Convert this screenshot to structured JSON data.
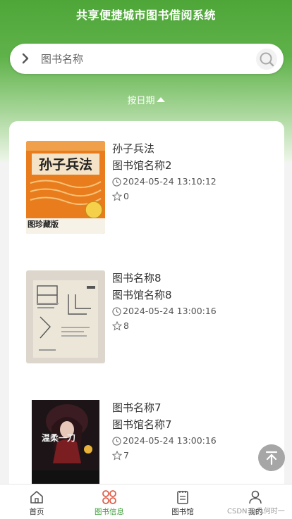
{
  "header": {
    "title": "共享便捷城市图书借阅系统"
  },
  "search": {
    "placeholder": "图书名称"
  },
  "sort": {
    "label": "按日期"
  },
  "books": [
    {
      "name": "孙子兵法",
      "library": "图书馆名称2",
      "time": "2024-05-24 13:10:12",
      "stars": "0"
    },
    {
      "name": "图书名称8",
      "library": "图书馆名称8",
      "time": "2024-05-24 13:00:16",
      "stars": "8"
    },
    {
      "name": "图书名称7",
      "library": "图书馆名称7",
      "time": "2024-05-24 13:00:16",
      "stars": "7"
    }
  ],
  "covers": {
    "c1_title": "孙子兵法",
    "c1_sub": "图珍藏版",
    "c3_title": "温柔一刀"
  },
  "nav": [
    {
      "label": "首页"
    },
    {
      "label": "图书信息"
    },
    {
      "label": "图书馆"
    },
    {
      "label": "我的"
    }
  ],
  "watermark": "CSDN @几何时一",
  "colors": {
    "brand": "#4ea638",
    "active": "#3c9b37"
  }
}
